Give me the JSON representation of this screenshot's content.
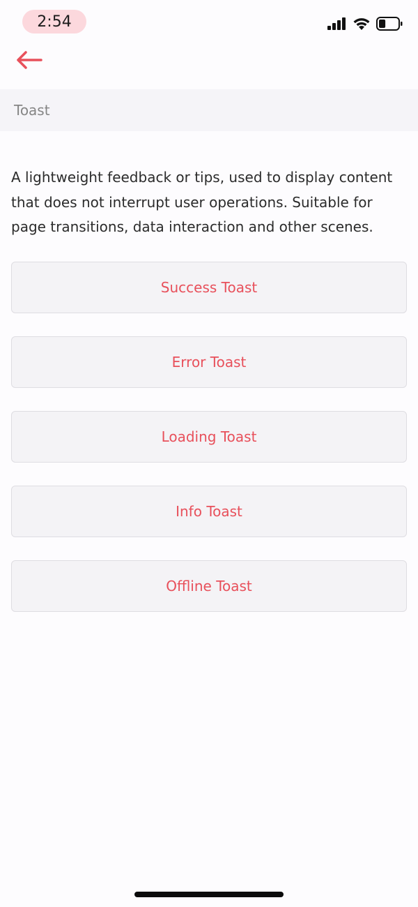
{
  "status_bar": {
    "time": "2:54",
    "signal_icon": "cellular-signal-icon",
    "wifi_icon": "wifi-icon",
    "battery_icon": "battery-icon",
    "battery_level": 0.35
  },
  "nav": {
    "back_icon": "arrow-left-icon",
    "accent_color": "#e8505b"
  },
  "section": {
    "title": "Toast"
  },
  "description": "A lightweight feedback or tips, used to display content that does not interrupt user operations. Suitable for page transitions, data interaction and other scenes.",
  "buttons": [
    {
      "label": "Success Toast"
    },
    {
      "label": "Error Toast"
    },
    {
      "label": "Loading Toast"
    },
    {
      "label": "Info Toast"
    },
    {
      "label": "Offline Toast"
    }
  ],
  "colors": {
    "accent": "#e8505b",
    "button_bg": "#f4f3f6",
    "header_bg": "#f5f4f8",
    "time_pill": "#fcd8dd"
  }
}
